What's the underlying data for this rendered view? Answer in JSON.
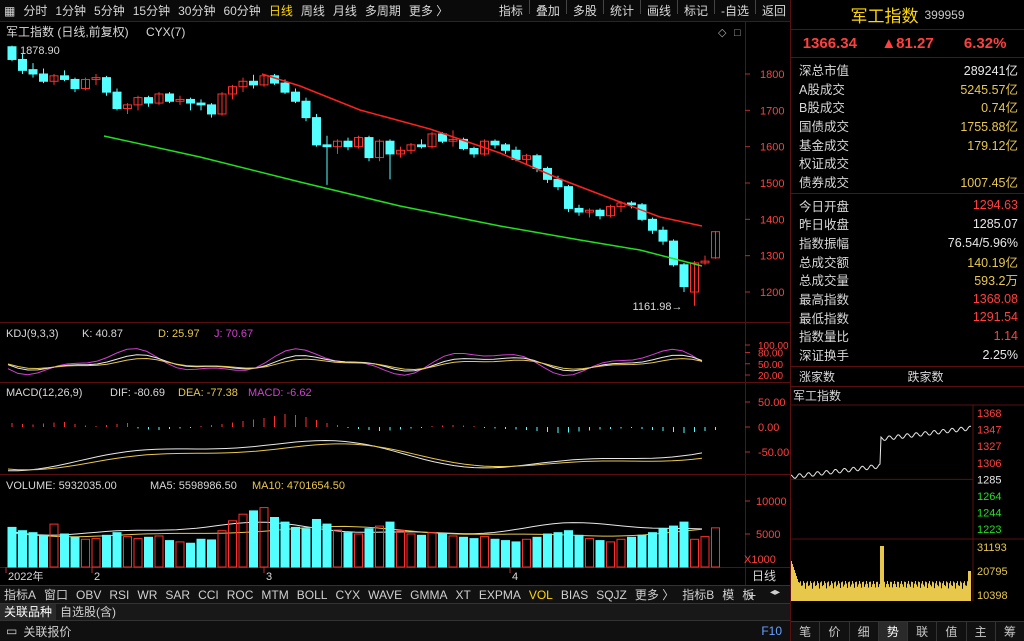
{
  "toolbar": {
    "periods": [
      "分时",
      "1分钟",
      "5分钟",
      "15分钟",
      "30分钟",
      "60分钟",
      "日线",
      "周线",
      "月线",
      "多周期",
      "更多 〉"
    ],
    "active_period": "日线",
    "tools": [
      "指标",
      "叠加",
      "多股",
      "统计",
      "画线",
      "标记",
      "-自选",
      "返回"
    ]
  },
  "chart_header": {
    "title": "军工指数 (日线,前复权)",
    "indicator": "CYX(7)",
    "max_label": "1878.90",
    "min_label": "1161.98"
  },
  "price_axis": [
    "1800",
    "1700",
    "1600",
    "1500",
    "1400",
    "1300",
    "1200"
  ],
  "kdj": {
    "name": "KDJ(9,3,3)",
    "k": "K: 40.87",
    "d": "D: 25.97",
    "j": "J: 70.67",
    "ticks": [
      "100.00",
      "80.00",
      "50.00",
      "20.00"
    ]
  },
  "macd": {
    "name": "MACD(12,26,9)",
    "dif": "DIF: -80.69",
    "dea": "DEA: -77.38",
    "macd": "MACD: -6.62",
    "ticks": [
      "50.00",
      "0.00",
      "-50.00"
    ]
  },
  "volume": {
    "name": "VOLUME: 5932035.00",
    "ma5": "MA5: 5598986.50",
    "ma10": "MA10: 4701654.50",
    "ticks": [
      "10000",
      "5000"
    ],
    "unit": "X1000"
  },
  "date_axis": {
    "labels": [
      "2022年",
      "2",
      "3",
      "4"
    ],
    "period": "日线"
  },
  "indicator_tabs": [
    "指标A",
    "窗口",
    "OBV",
    "RSI",
    "WR",
    "SAR",
    "CCI",
    "ROC",
    "MTM",
    "BOLL",
    "CYX",
    "WAVE",
    "GMMA",
    "XT",
    "EXPMA",
    "VOL",
    "BIAS",
    "SQJZ",
    "更多 〉",
    "指标B",
    "模",
    "板"
  ],
  "active_indicator": "VOL",
  "tabs2": [
    "关联品种",
    "自选股(含)"
  ],
  "status": {
    "left": "关联报价",
    "right": "F10"
  },
  "quote": {
    "name": "军工指数",
    "code": "399959",
    "price": "1366.34",
    "change": "▲81.27",
    "pct": "6.32%",
    "group1": [
      {
        "label": "深总市值",
        "value": "289241亿",
        "color": "white"
      },
      {
        "label": "A股成交",
        "value": "5245.57亿",
        "color": "yel"
      },
      {
        "label": "B股成交",
        "value": "0.74亿",
        "color": "yel"
      },
      {
        "label": "国债成交",
        "value": "1755.88亿",
        "color": "yel"
      },
      {
        "label": "基金成交",
        "value": "179.12亿",
        "color": "yel"
      },
      {
        "label": "权证成交",
        "value": "",
        "color": "yel"
      },
      {
        "label": "债券成交",
        "value": "1007.45亿",
        "color": "yel"
      }
    ],
    "group2": [
      {
        "label": "今日开盘",
        "value": "1294.63",
        "color": "red"
      },
      {
        "label": "昨日收盘",
        "value": "1285.07",
        "color": "white"
      },
      {
        "label": "指数振幅",
        "value": "76.54/5.96%",
        "color": "white"
      },
      {
        "label": "总成交额",
        "value": "140.19亿",
        "color": "yel"
      },
      {
        "label": "总成交量",
        "value": "593.2万",
        "color": "yel"
      },
      {
        "label": "最高指数",
        "value": "1368.08",
        "color": "red"
      },
      {
        "label": "最低指数",
        "value": "1291.54",
        "color": "red"
      },
      {
        "label": "指数量比",
        "value": "1.14",
        "color": "red"
      },
      {
        "label": "深证换手",
        "value": "2.25%",
        "color": "white"
      }
    ],
    "updown": [
      "涨家数",
      "跌家数"
    ],
    "mini_title": "军工指数",
    "mini_price_ticks": [
      "1368",
      "1347",
      "1327",
      "1306",
      "1285",
      "1264",
      "1244",
      "1223"
    ],
    "mini_vol_ticks": [
      "31193",
      "20795",
      "10398"
    ],
    "bottom_tabs": [
      "笔",
      "价",
      "细",
      "势",
      "联",
      "值",
      "主",
      "筹"
    ],
    "active_tab": "势"
  }
}
